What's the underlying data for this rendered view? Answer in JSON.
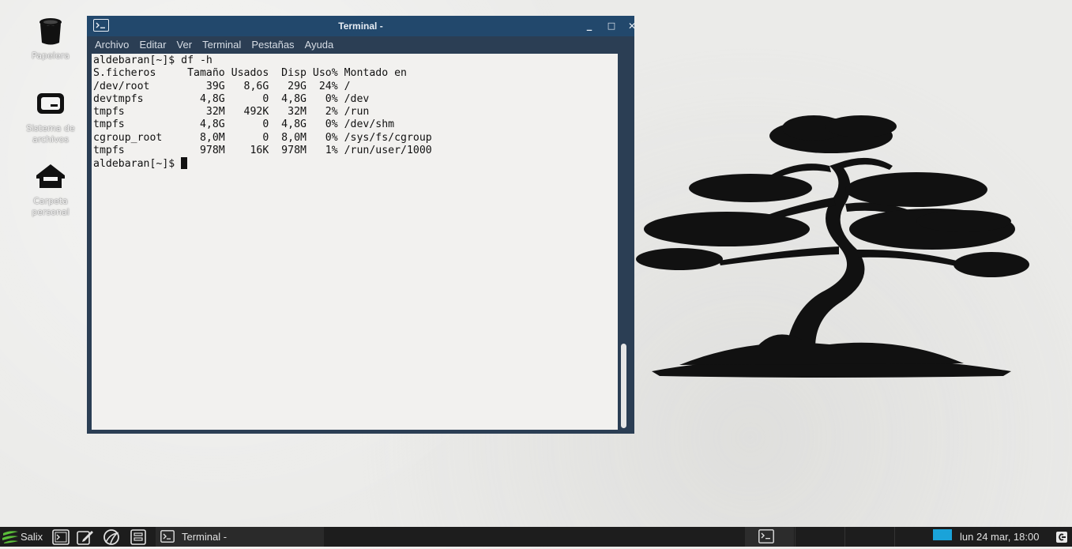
{
  "desktop": {
    "icons": [
      {
        "label": "Papelera",
        "icon": "trash-icon"
      },
      {
        "label": "Sistema de archivos",
        "icon": "drive-icon"
      },
      {
        "label": "Carpeta personal",
        "icon": "home-icon"
      }
    ]
  },
  "window": {
    "title": "Terminal -",
    "controls": {
      "minimize": "_",
      "maximize": "□",
      "close": "✕"
    },
    "menu": [
      "Archivo",
      "Editar",
      "Ver",
      "Terminal",
      "Pestañas",
      "Ayuda"
    ]
  },
  "terminal": {
    "output": "aldebaran[~]$ df -h\nS.ficheros     Tamaño Usados  Disp Uso% Montado en\n/dev/root         39G   8,6G   29G  24% /\ndevtmpfs         4,8G      0  4,8G   0% /dev\ntmpfs             32M   492K   32M   2% /run\ntmpfs            4,8G      0  4,8G   0% /dev/shm\ncgroup_root      8,0M      0  8,0M   0% /sys/fs/cgroup\ntmpfs            978M    16K  978M   1% /run/user/1000\n",
    "prompt": "aldebaran[~]$ "
  },
  "taskbar": {
    "menu_label": "Salix",
    "launchers": [
      "terminal-icon",
      "text-editor-icon",
      "browser-icon",
      "file-manager-icon"
    ],
    "task_label": "Terminal -",
    "clock": "lun 24 mar, 18:00"
  },
  "colors": {
    "titlebar": "#22486c",
    "window_frame": "#2b3e54",
    "terminal_bg": "#f2f1ef",
    "taskbar": "#1d1d1d",
    "salix_green": "#5bbf3a",
    "workspace_active": "#1aa3d9"
  }
}
